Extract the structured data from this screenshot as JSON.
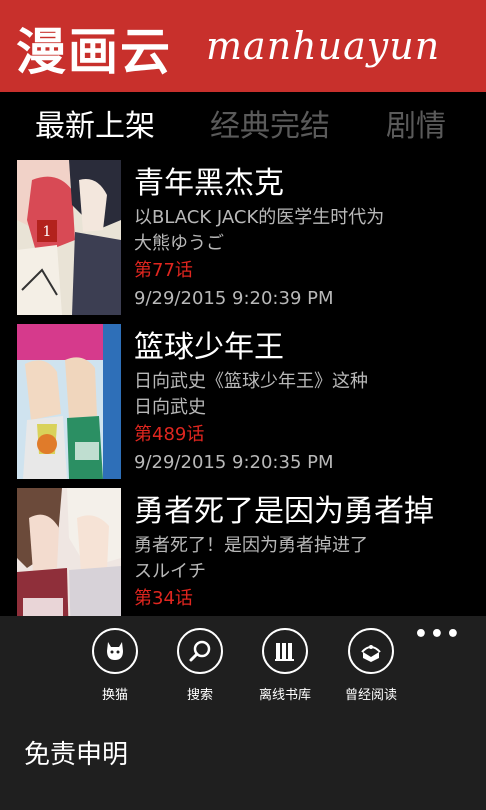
{
  "header": {
    "title_cn": "漫画云",
    "title_en": "manhuayun"
  },
  "pivot": {
    "items": [
      {
        "label": "最新上架",
        "active": true
      },
      {
        "label": "经典完结",
        "active": false
      },
      {
        "label": "剧情",
        "active": false
      }
    ]
  },
  "comics": [
    {
      "title": "青年黑杰克",
      "description": "以BLACK JACK的医学生时代为",
      "author": "大熊ゆうご",
      "chapter": "第77话",
      "updated": "9/29/2015 9:20:39 PM"
    },
    {
      "title": "篮球少年王",
      "description": "日向武史《篮球少年王》这种",
      "author": "日向武史",
      "chapter": "第489话",
      "updated": "9/29/2015 9:20:35 PM"
    },
    {
      "title": "勇者死了是因为勇者掉",
      "description": "勇者死了！是因为勇者掉进了",
      "author": "スルイチ",
      "chapter": "第34话",
      "updated": ""
    }
  ],
  "appbar": {
    "more": "•••",
    "buttons": [
      {
        "label": "换猫",
        "icon": "cat-icon"
      },
      {
        "label": "搜索",
        "icon": "search-icon"
      },
      {
        "label": "离线书库",
        "icon": "bookshelf-icon"
      },
      {
        "label": "曾经阅读",
        "icon": "history-reader-icon"
      }
    ],
    "menu_items": [
      "免责申明"
    ]
  },
  "colors": {
    "header_bg": "#c8302c",
    "chapter_red": "#e0261f",
    "appbar_bg": "#1f1f1f"
  }
}
